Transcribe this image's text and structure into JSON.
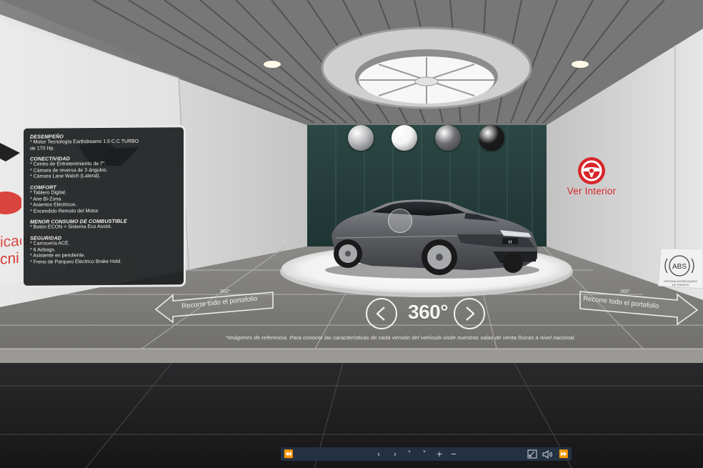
{
  "specs": {
    "sections": [
      {
        "heading": "DESEMPEÑO",
        "lines": [
          "* Motor Tecnología Earthdreams 1,5 C.C TURBO",
          "de 170 Hp."
        ]
      },
      {
        "heading": "CONECTIVIDAD",
        "lines": [
          "* Centro de Entretenimiento de 7\".",
          "* Cámara de reversa de 3 ángulos.",
          "* Cámara Lane Watch (Lateral)."
        ]
      },
      {
        "heading": "COMFORT",
        "lines": [
          "* Tablero Digital.",
          "* Aire Bi-Zona.",
          "* Asientos Eléctricos.",
          "* Encendido Remoto del Motor."
        ]
      },
      {
        "heading": "MENOR CONSUMO DE COMBUSTIBLE",
        "lines": [
          "* Botón ECON + Sistema Eco Assist."
        ]
      },
      {
        "heading": "SEGURIDAD",
        "lines": [
          "* Carrocería ACE.",
          "* 6 Airbags.",
          "* Asistente en pendiente.",
          "* Freno de Parqueo Eléctrico Brake Hold."
        ]
      }
    ]
  },
  "left_wall": {
    "line1": "icacione",
    "line2": "cni"
  },
  "color_swatches": [
    {
      "name": "silver",
      "color": "#b8b9bb"
    },
    {
      "name": "white",
      "color": "#f4f4f4"
    },
    {
      "name": "gray",
      "color": "#6d6e71"
    },
    {
      "name": "black",
      "color": "#1b1b1c"
    }
  ],
  "interior": {
    "label": "Ver Interior",
    "icon": "steering-wheel-icon",
    "color": "#d8262a"
  },
  "viewer": {
    "label_360": "360°",
    "prev_icon": "chevron-left-icon",
    "next_icon": "chevron-right-icon"
  },
  "disclaimer": "*Imágenes de referencia. Para conocer las características de cada versión del vehículo visite nuestras salas de venta físicas a nivel nacional.",
  "signs": {
    "left": {
      "small": "360°",
      "text": "Recorre todo el portafolio"
    },
    "right": {
      "small": "360°",
      "text": "Recorre todo el portafolio"
    },
    "abs": {
      "badge": "ABS",
      "caption_line1": "SISTEMA ANTIBLOQUEO",
      "caption_line2": "DE FRENOS"
    }
  },
  "toolbar": {
    "rewind": "⏪",
    "left": "‹",
    "right": "›",
    "up": "˄",
    "down": "˅",
    "zoom_in": "+",
    "zoom_out": "−",
    "fullscreen": "⤡",
    "sound": "🔈",
    "forward": "⏩"
  }
}
